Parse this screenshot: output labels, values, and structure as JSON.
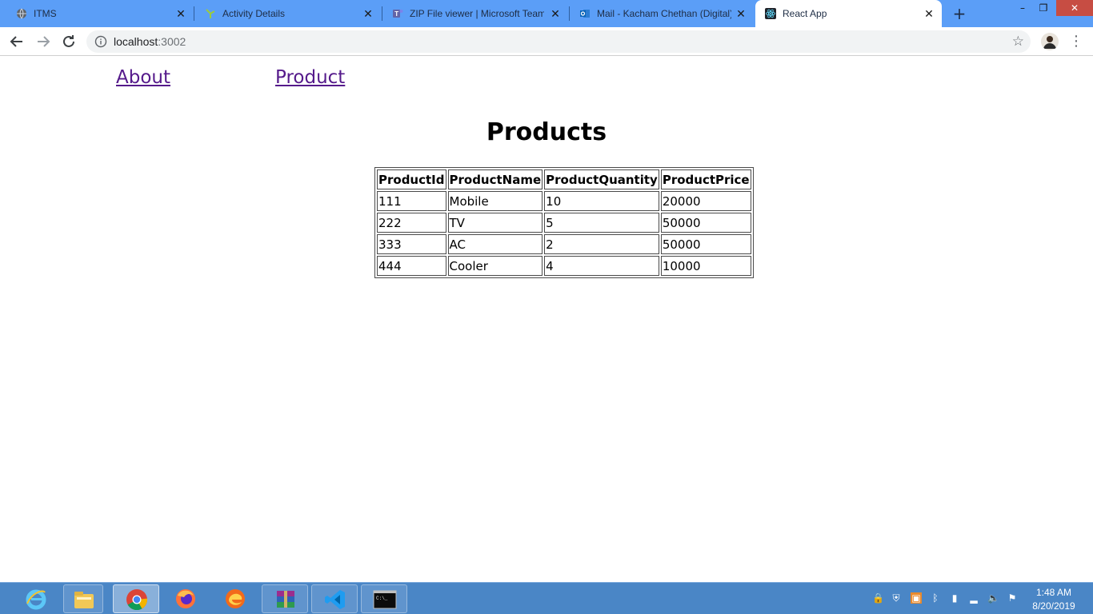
{
  "browser": {
    "tabs": [
      {
        "title": "ITMS",
        "icon": "globe-icon"
      },
      {
        "title": "Activity Details",
        "icon": "activity-icon"
      },
      {
        "title": "ZIP File viewer | Microsoft Teams",
        "icon": "teams-icon"
      },
      {
        "title": "Mail - Kacham Chethan (Digital)",
        "icon": "outlook-icon"
      },
      {
        "title": "React App",
        "icon": "react-icon",
        "active": true
      }
    ],
    "address": {
      "host": "localhost",
      "port": ":3002"
    },
    "accent_color": "#5b9ef7"
  },
  "page": {
    "nav": {
      "about": "About",
      "product": "Product"
    },
    "title": "Products",
    "table": {
      "headers": [
        "ProductId",
        "ProductName",
        "ProductQuantity",
        "ProductPrice"
      ],
      "rows": [
        [
          "111",
          "Mobile",
          "10",
          "20000"
        ],
        [
          "222",
          "TV",
          "5",
          "50000"
        ],
        [
          "333",
          "AC",
          "2",
          "50000"
        ],
        [
          "444",
          "Cooler",
          "4",
          "10000"
        ]
      ]
    },
    "link_color": "#551a8b"
  },
  "taskbar": {
    "apps": [
      "internet-explorer-icon",
      "file-explorer-icon",
      "chrome-icon",
      "firefox-icon",
      "edge-icon",
      "winrar-icon",
      "vscode-icon",
      "cmd-icon"
    ],
    "clock": {
      "time": "1:48 AM",
      "date": "8/20/2019"
    }
  }
}
